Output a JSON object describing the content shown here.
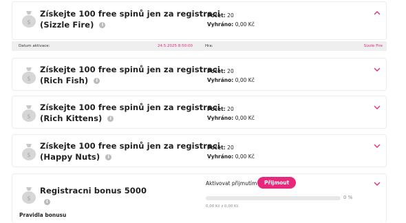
{
  "accent_color": "#e6297b",
  "cards": [
    {
      "title_line1": "Získejte 100 free spinů jen za registraci",
      "title_line2": "(Sizzle Fire)",
      "count_label": "Počet:",
      "count_value": "20",
      "won_label": "Vyhráno:",
      "won_value": "0,00 Kč",
      "expanded": true
    },
    {
      "title_line1": "Získejte 100 free spinů jen za registraci",
      "title_line2": "(Rich Fish)",
      "count_label": "Počet:",
      "count_value": "20",
      "won_label": "Vyhráno:",
      "won_value": "0,00 Kč",
      "expanded": false
    },
    {
      "title_line1": "Získejte 100 free spinů jen za registraci",
      "title_line2": "(Rich Kittens)",
      "count_label": "Počet:",
      "count_value": "20",
      "won_label": "Vyhráno:",
      "won_value": "0,00 Kč",
      "expanded": false
    },
    {
      "title_line1": "Získejte 100 free spinů jen za registraci",
      "title_line2": "(Happy Nuts)",
      "count_label": "Počet:",
      "count_value": "20",
      "won_label": "Vyhráno:",
      "won_value": "0,00 Kč",
      "expanded": false
    }
  ],
  "details": {
    "activation_label": "Datum aktivace:",
    "activation_value": "24.5.2025 8:50:00",
    "game_label": "Hra:",
    "game_value": "Sizzle Fire"
  },
  "bonus": {
    "title": "Registracni bonus 5000",
    "activate_label": "Aktivovat přijmutím",
    "accept_button": "Přijmout",
    "progress_fraction": 0,
    "progress_percent": "0 %",
    "progress_amount": "0,00 Kč z 0,00 Kč",
    "rules_label": "Pravidla bonusu"
  },
  "icons": {
    "bag": "money-bag-icon",
    "info": "info-icon",
    "chevron_up": "chevron-up-icon",
    "chevron_down": "chevron-down-icon"
  }
}
